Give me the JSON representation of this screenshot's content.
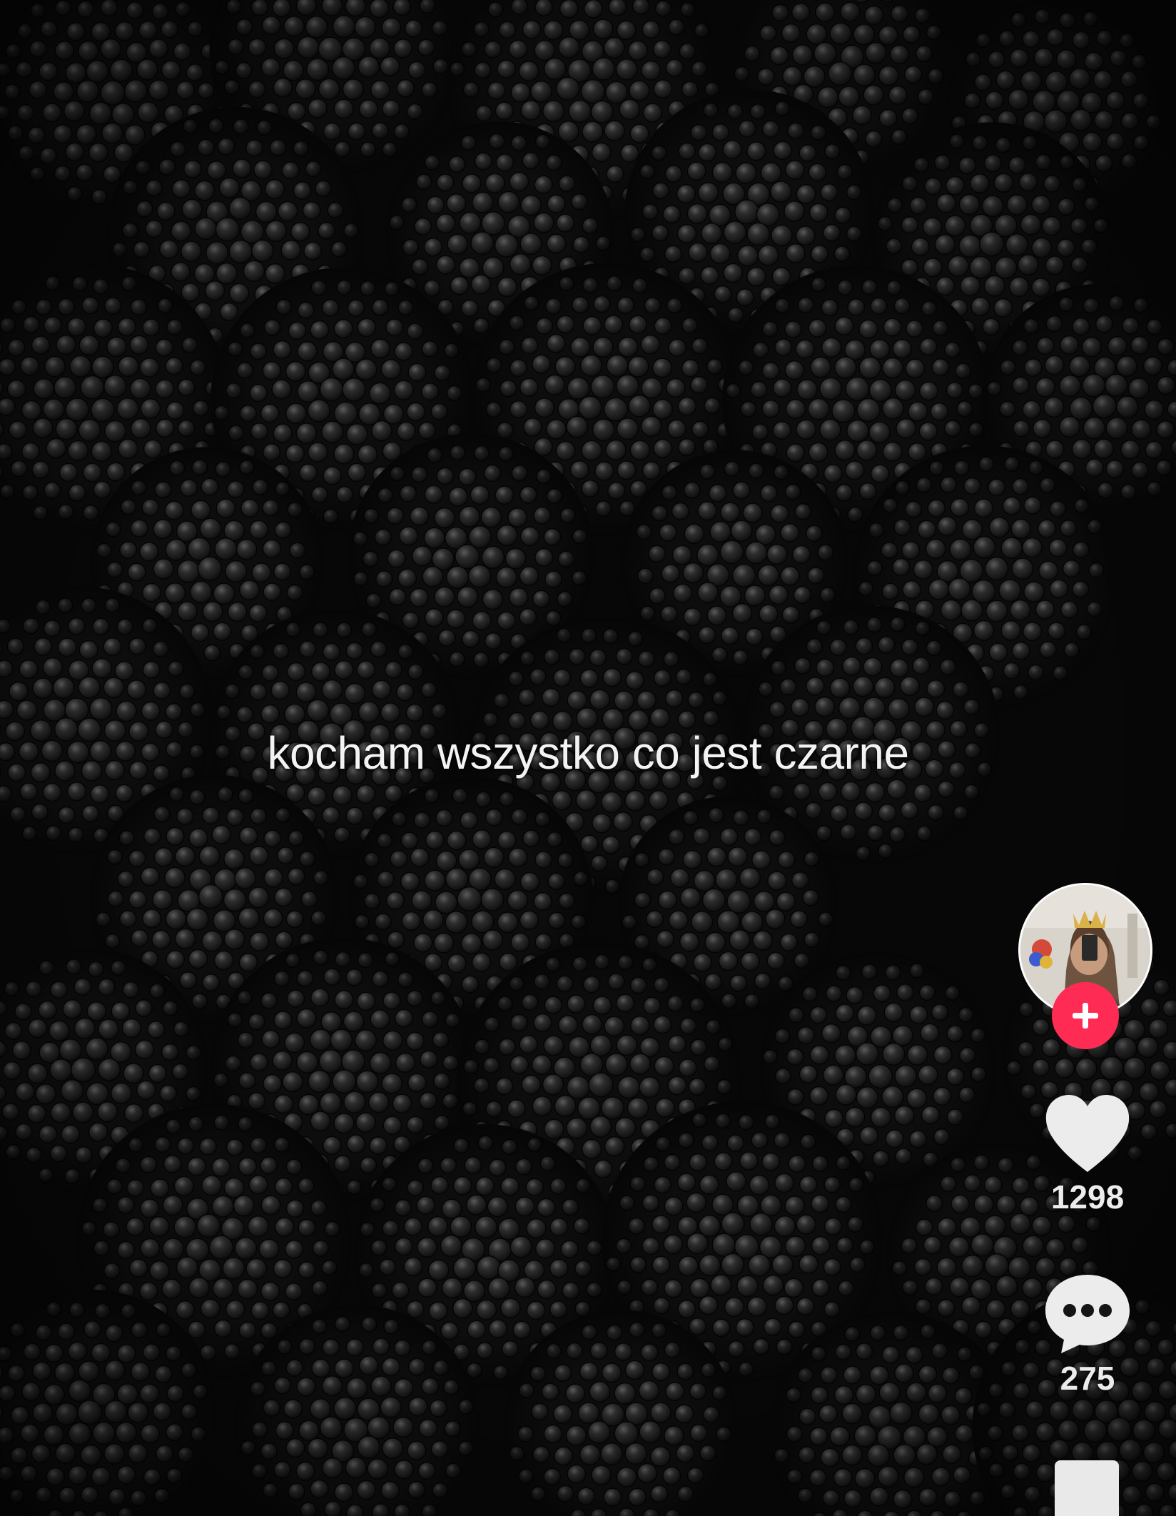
{
  "video": {
    "caption": "kocham wszystko co jest czarne",
    "subject": "blackberries close-up"
  },
  "creator": {
    "avatar_icon": "profile-photo",
    "follow_icon": "plus-icon",
    "follow_color": "#fe2c55"
  },
  "actions": {
    "like": {
      "icon": "heart-icon",
      "count": "1298"
    },
    "comment": {
      "icon": "comment-bubble-icon",
      "count": "275"
    },
    "share": {
      "icon": "share-icon"
    }
  },
  "colors": {
    "background": "#0a0a0a",
    "text": "#f3f3f3",
    "accent": "#fe2c55"
  }
}
